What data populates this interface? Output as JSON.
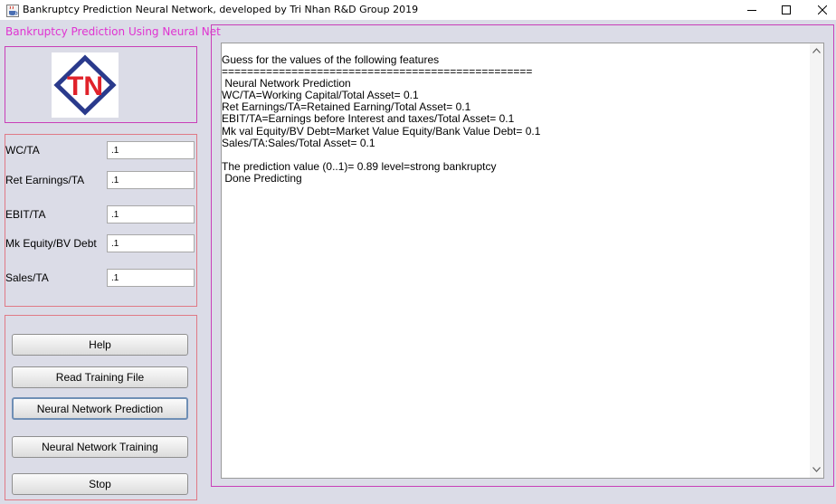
{
  "window": {
    "title": "Bankruptcy Prediction Neural Network, developed by Tri Nhan R&D Group 2019",
    "controls": {
      "minimize": "minimize-icon",
      "maximize": "maximize-icon",
      "close": "close-icon"
    }
  },
  "app": {
    "heading": "Bankruptcy Prediction Using Neural Net",
    "heading_color": "#e033d1",
    "logo": {
      "text": "TN",
      "diamond_color": "#2a3a8c",
      "text_color": "#e0222a"
    }
  },
  "features": [
    {
      "label": "WC/TA",
      "value": ".1"
    },
    {
      "label": "Ret Earnings/TA",
      "value": ".1"
    },
    {
      "label": "EBIT/TA",
      "value": ".1"
    },
    {
      "label": "Mk Equity/BV Debt",
      "value": ".1"
    },
    {
      "label": "Sales/TA",
      "value": ".1"
    }
  ],
  "buttons": {
    "help": "Help",
    "read_training_file": "Read Training File",
    "neural_network_prediction": "Neural Network Prediction",
    "neural_network_training": "Neural Network Training",
    "stop": "Stop"
  },
  "output": {
    "lines": [
      "Guess for the values of the following features",
      "=================================================",
      " Neural Network Prediction",
      "WC/TA=Working Capital/Total Asset= 0.1",
      "Ret Earnings/TA=Retained Earning/Total Asset= 0.1",
      "EBIT/TA=Earnings before Interest and taxes/Total Asset= 0.1",
      "Mk val Equity/BV Debt=Market Value Equity/Bank Value Debt= 0.1",
      "Sales/TA:Sales/Total Asset= 0.1",
      "",
      "The prediction value (0..1)= 0.89 level=strong bankruptcy",
      " Done Predicting"
    ]
  }
}
